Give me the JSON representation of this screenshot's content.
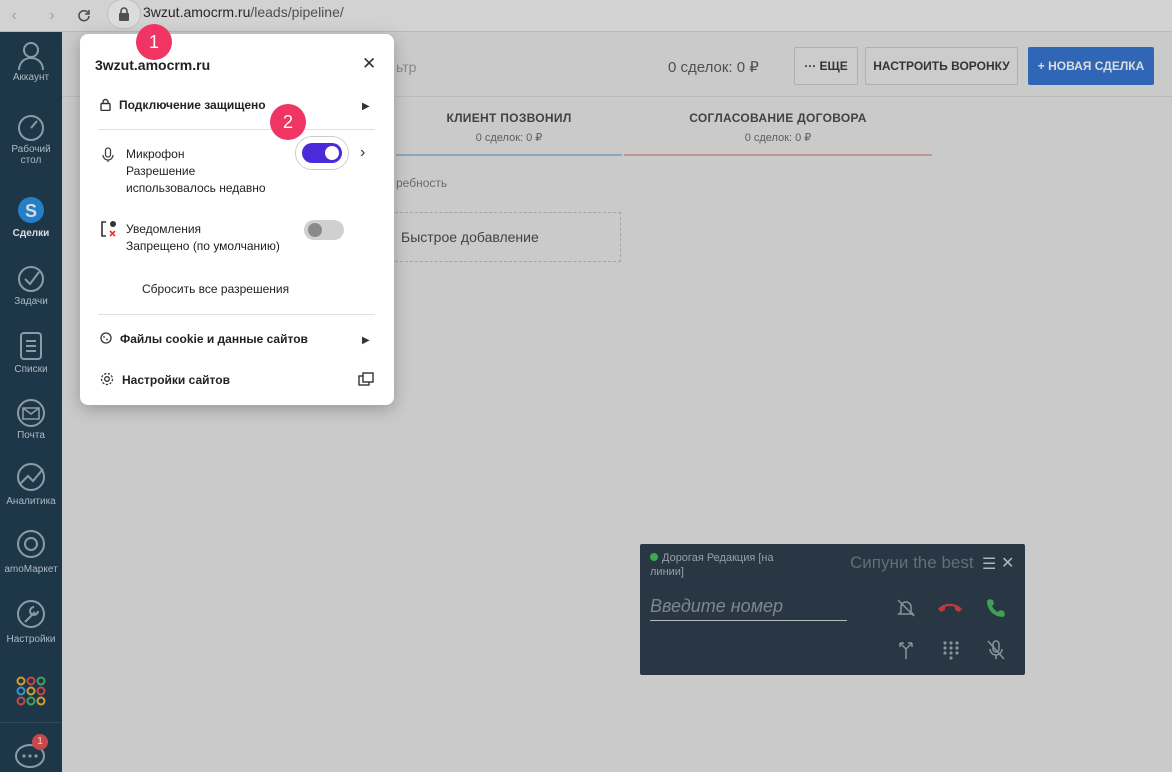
{
  "browser": {
    "url_host": "3wzut.amocrm.ru",
    "url_path": "/leads/pipeline/"
  },
  "sidebar": {
    "items": [
      {
        "label": "Аккаунт",
        "icon": "user-icon"
      },
      {
        "label": "Рабочий стол",
        "icon": "dashboard-icon"
      },
      {
        "label": "Сделки",
        "icon": "deals-icon"
      },
      {
        "label": "Задачи",
        "icon": "tasks-icon"
      },
      {
        "label": "Списки",
        "icon": "lists-icon"
      },
      {
        "label": "Почта",
        "icon": "mail-icon"
      },
      {
        "label": "Аналитика",
        "icon": "analytics-icon"
      },
      {
        "label": "amoМаркет",
        "icon": "market-icon"
      },
      {
        "label": "Настройки",
        "icon": "settings-icon"
      }
    ],
    "chat_badge": "1"
  },
  "topbar": {
    "filter_text": "ьтр",
    "deals_count": "0 сделок: 0 ₽",
    "more_label": "··· ЕЩЕ",
    "setup_label": "НАСТРОИТЬ ВОРОНКУ",
    "new_label": "+ НОВАЯ СДЕЛКА"
  },
  "pipeline": {
    "columns": [
      {
        "title": "КЛИЕНТ ПОЗВОНИЛ",
        "count": "0 сделок: 0 ₽"
      },
      {
        "title": "СОГЛАСОВАНИЕ ДОГОВОРА",
        "count": "0 сделок: 0 ₽"
      }
    ],
    "need_text": "ребность",
    "quick_add": "Быстрое добавление"
  },
  "phone": {
    "status": "Дорогая Редакция [на линии]",
    "name": "Сипуни the best",
    "placeholder": "Введите номер"
  },
  "popup": {
    "title": "3wzut.amocrm.ru",
    "connection": "Подключение защищено",
    "mic_label": "Микрофон",
    "mic_sub": "Разрешение использовалось недавно",
    "mic_enabled": true,
    "notif_label": "Уведомления",
    "notif_sub": "Запрещено (по умолчанию)",
    "notif_enabled": false,
    "reset": "Сбросить все разрешения",
    "cookies": "Файлы cookie и данные сайтов",
    "site_settings": "Настройки сайтов"
  },
  "badges": {
    "one": "1",
    "two": "2"
  },
  "colors": {
    "sidebar": "#17364c",
    "primary_button": "#2d6fd1",
    "toggle_on": "#4a2ad9",
    "badge": "#f03565",
    "phone_bg": "#253545"
  }
}
